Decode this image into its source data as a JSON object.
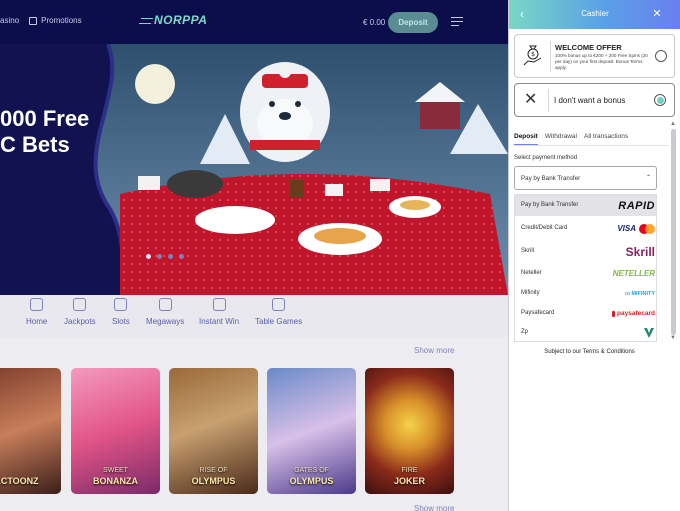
{
  "site": {
    "nav_partial": "asino",
    "promotions_label": "Promotions",
    "logo_text": "NORPPA",
    "balance": "€ 0.00",
    "deposit_label": "Deposit",
    "hero_line1": "000 Free",
    "hero_line2": "C Bets",
    "categories": [
      {
        "label": "Home",
        "icon": "home-icon"
      },
      {
        "label": "Jackpots",
        "icon": "trophy-icon"
      },
      {
        "label": "Slots",
        "icon": "slot-machine-icon"
      },
      {
        "label": "Megaways",
        "icon": "megaways-icon"
      },
      {
        "label": "Instant Win",
        "icon": "instant-win-icon"
      },
      {
        "label": "Table Games",
        "icon": "cards-icon"
      }
    ],
    "show_more": "Show more",
    "games": [
      {
        "name": "ACTOONZ",
        "sub": ""
      },
      {
        "name": "BONANZA",
        "sub": "SWEET"
      },
      {
        "name": "OLYMPUS",
        "sub": "RISE OF"
      },
      {
        "name": "OLYMPUS",
        "sub": "GATES OF"
      },
      {
        "name": "JOKER",
        "sub": "FIRE"
      }
    ]
  },
  "cashier": {
    "title": "Cashier",
    "welcome": {
      "title": "WELCOME OFFER",
      "description": "100% bonus up to €200 + 200 Free Spins (20 per day) on your first deposit. Bonus Terms apply."
    },
    "no_bonus_label": "I don't want a bonus",
    "tabs": [
      "Deposit",
      "Withdrawal",
      "All transactions"
    ],
    "payment_method_label": "Select payment method",
    "selected_method": "Pay by Bank Transfer",
    "methods": [
      {
        "name": "Pay by Bank Transfer",
        "brand": "RAPID"
      },
      {
        "name": "Credit/Debit Card",
        "brand": "VISA"
      },
      {
        "name": "Skrill",
        "brand": "Skrill"
      },
      {
        "name": "Neteller",
        "brand": "NETELLER"
      },
      {
        "name": "Mifinity",
        "brand": "MIFINITY"
      },
      {
        "name": "Paysafecard",
        "brand": "paysafecard"
      },
      {
        "name": "Zp",
        "brand": ""
      }
    ],
    "terms": "Subject to our Terms & Conditions"
  }
}
